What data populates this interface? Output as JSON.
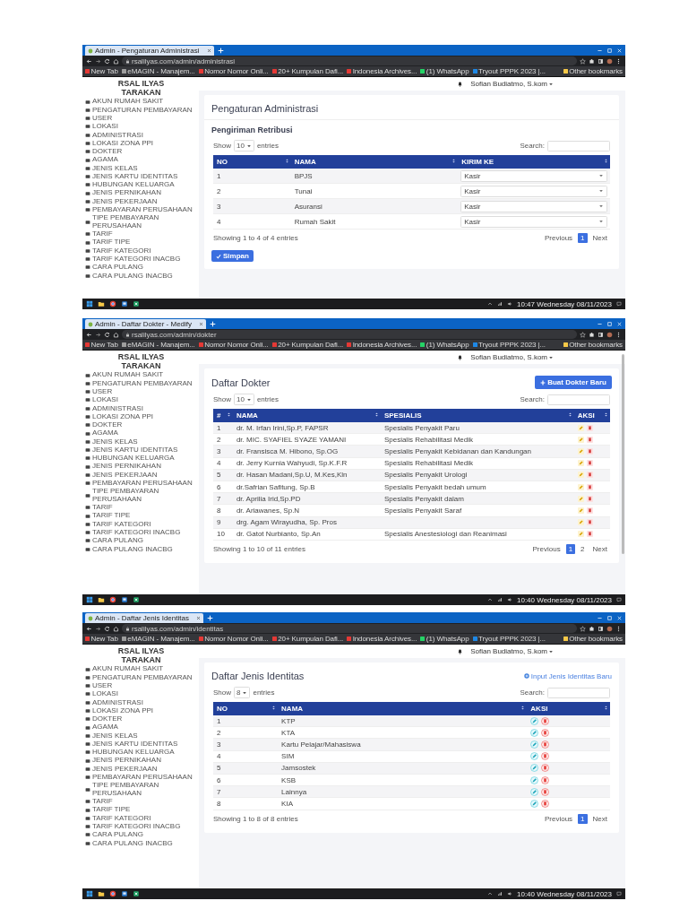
{
  "screens": [
    {
      "browser": {
        "tab_title": "Admin - Pengaturan Administrasi",
        "url": "rsalilyas.com/admin/administrasi",
        "bookmarks": [
          "New Tab",
          "eMAGIN - Manajem...",
          "Nomor Nomor Onli...",
          "20+ Kumpulan Dafi...",
          "Indonesia Archives...",
          "(1) WhatsApp",
          "Tryout PPPK 2023 |..."
        ],
        "other_bookmarks": "Other bookmarks"
      },
      "sidebar": {
        "brand": "RSAL ILYAS TARAKAN",
        "items": [
          "AKUN RUMAH SAKIT",
          "PENGATURAN PEMBAYARAN",
          "USER",
          "LOKASI",
          "ADMINISTRASI",
          "LOKASI ZONA PPI",
          "DOKTER",
          "AGAMA",
          "JENIS KELAS",
          "JENIS KARTU IDENTITAS",
          "HUBUNGAN KELUARGA",
          "JENIS PERNIKAHAN",
          "JENIS PEKERJAAN",
          "PEMBAYARAN PERUSAHAAN",
          "TIPE PEMBAYARAN PERUSAHAAN",
          "TARIF",
          "TARIF TIPE",
          "TARIF KATEGORI",
          "TARIF KATEGORI INACBG",
          "CARA PULANG",
          "CARA PULANG INACBG"
        ]
      },
      "navbar": {
        "user": "Sofian Budiatmo, S.kom"
      },
      "content": {
        "title": "Pengaturan Administrasi",
        "section_title": "Pengiriman Retribusi",
        "show_label": "Show",
        "length_value": "10",
        "entries_label": "entries",
        "search_label": "Search:",
        "columns": [
          {
            "label": "NO",
            "kind": "text"
          },
          {
            "label": "NAMA",
            "kind": "text"
          },
          {
            "label": "KIRIM KE",
            "kind": "select"
          }
        ],
        "rows": [
          [
            "1",
            "BPJS",
            "Kasir"
          ],
          [
            "2",
            "Tunai",
            "Kasir"
          ],
          [
            "3",
            "Asuransi",
            "Kasir"
          ],
          [
            "4",
            "Rumah Sakit",
            "Kasir"
          ]
        ],
        "info": "Showing 1 to 4 of 4 entries",
        "pages": [
          {
            "label": "Previous",
            "selected": false
          },
          {
            "label": "1",
            "selected": true
          },
          {
            "label": "Next",
            "selected": false
          }
        ],
        "submit": "Simpan"
      },
      "taskbar": {
        "time": "10:47",
        "day": "Wednesday",
        "date": "08/11/2023"
      }
    },
    {
      "browser": {
        "tab_title": "Admin - Daftar Dokter - Medify",
        "url": "rsalilyas.com/admin/dokter",
        "bookmarks": [
          "New Tab",
          "eMAGIN - Manajem...",
          "Nomor Nomor Onli...",
          "20+ Kumpulan Dafi...",
          "Indonesia Archives...",
          "(1) WhatsApp",
          "Tryout PPPK 2023 |..."
        ],
        "other_bookmarks": "Other bookmarks"
      },
      "sidebar": {
        "brand": "RSAL ILYAS TARAKAN",
        "items": [
          "AKUN RUMAH SAKIT",
          "PENGATURAN PEMBAYARAN",
          "USER",
          "LOKASI",
          "ADMINISTRASI",
          "LOKASI ZONA PPI",
          "DOKTER",
          "AGAMA",
          "JENIS KELAS",
          "JENIS KARTU IDENTITAS",
          "HUBUNGAN KELUARGA",
          "JENIS PERNIKAHAN",
          "JENIS PEKERJAAN",
          "PEMBAYARAN PERUSAHAAN",
          "TIPE PEMBAYARAN PERUSAHAAN",
          "TARIF",
          "TARIF TIPE",
          "TARIF KATEGORI",
          "TARIF KATEGORI INACBG",
          "CARA PULANG",
          "CARA PULANG INACBG"
        ]
      },
      "navbar": {
        "user": "Sofian Budiatmo, S.kom"
      },
      "content": {
        "title": "Daftar Dokter",
        "action": {
          "kind": "button",
          "label": "Buat Dokter Baru"
        },
        "show_label": "Show",
        "length_value": "10",
        "entries_label": "entries",
        "search_label": "Search:",
        "columns": [
          {
            "label": "#",
            "kind": "text"
          },
          {
            "label": "NAMA",
            "kind": "text"
          },
          {
            "label": "SPESIALIS",
            "kind": "text"
          },
          {
            "label": "AKSI",
            "kind": "actions"
          }
        ],
        "rows": [
          [
            "1",
            "dr. M. Irfan Irini,Sp.P, FAPSR",
            "Spesialis Penyakit Paru"
          ],
          [
            "2",
            "dr. MIC. SYAFIEL SYAZE YAMANI",
            "Spesialis Rehabilitasi Medik"
          ],
          [
            "3",
            "dr. Fransisca M. Hibono, Sp.OG",
            "Spesialis Penyakit Kebidanan dan Kandungan"
          ],
          [
            "4",
            "dr. Jerry Kurnia Wahyudi, Sp.K.F.R",
            "Spesialis Rehabilitasi Medik"
          ],
          [
            "5",
            "dr. Hasan Madani,Sp.U, M.Kes,Kln",
            "Spesialis Penyakit Urologi"
          ],
          [
            "6",
            "dr.Safrian Safitung, Sp.B",
            "Spesialis Penyakit bedah umum"
          ],
          [
            "7",
            "dr. Aprilia Irid,Sp.PD",
            "Spesialis Penyakit dalam"
          ],
          [
            "8",
            "dr. Ariawanes, Sp.N",
            "Spesialis Penyakit Saraf"
          ],
          [
            "9",
            "drg. Agam Wirayudha, Sp. Pros",
            null
          ],
          [
            "10",
            "dr. Gatot Nurbianto, Sp.An",
            "Spesialis Anestesiologi dan Reanimasi"
          ]
        ],
        "info": "Showing 1 to 10 of 11 entries",
        "pages": [
          {
            "label": "Previous",
            "selected": false
          },
          {
            "label": "1",
            "selected": true
          },
          {
            "label": "2",
            "selected": false
          },
          {
            "label": "Next",
            "selected": false
          }
        ]
      },
      "scrollbar": true,
      "taskbar": {
        "time": "10:40",
        "day": "Wednesday",
        "date": "08/11/2023"
      }
    },
    {
      "browser": {
        "tab_title": "Admin - Daftar Jenis Identitas",
        "url": "rsalilyas.com/admin/identitas",
        "bookmarks": [
          "New Tab",
          "eMAGIN - Manajem...",
          "Nomor Nomor Onli...",
          "20+ Kumpulan Dafi...",
          "Indonesia Archives...",
          "(1) WhatsApp",
          "Tryout PPPK 2023 |..."
        ],
        "other_bookmarks": "Other bookmarks"
      },
      "sidebar": {
        "brand": "RSAL ILYAS TARAKAN",
        "items": [
          "AKUN RUMAH SAKIT",
          "PENGATURAN PEMBAYARAN",
          "USER",
          "LOKASI",
          "ADMINISTRASI",
          "LOKASI ZONA PPI",
          "DOKTER",
          "AGAMA",
          "JENIS KELAS",
          "JENIS KARTU IDENTITAS",
          "HUBUNGAN KELUARGA",
          "JENIS PERNIKAHAN",
          "JENIS PEKERJAAN",
          "PEMBAYARAN PERUSAHAAN",
          "TIPE PEMBAYARAN PERUSAHAAN",
          "TARIF",
          "TARIF TIPE",
          "TARIF KATEGORI",
          "TARIF KATEGORI INACBG",
          "CARA PULANG",
          "CARA PULANG INACBG"
        ]
      },
      "navbar": {
        "user": "Sofian Budiatmo, S.kom"
      },
      "content": {
        "title": "Daftar Jenis Identitas",
        "action": {
          "kind": "link",
          "label": "Input Jenis Identitas Baru"
        },
        "show_label": "Show",
        "length_value": "8",
        "entries_label": "entries",
        "search_label": "Search:",
        "columns": [
          {
            "label": "NO",
            "kind": "text"
          },
          {
            "label": "NAMA",
            "kind": "text"
          },
          {
            "label": "AKSI",
            "kind": "roundactions"
          }
        ],
        "rows": [
          [
            "1",
            "KTP"
          ],
          [
            "2",
            "KTA"
          ],
          [
            "3",
            "Kartu Pelajar/Mahasiswa"
          ],
          [
            "4",
            "SIM"
          ],
          [
            "5",
            "Jamsostek"
          ],
          [
            "6",
            "KSB"
          ],
          [
            "7",
            "Lainnya"
          ],
          [
            "8",
            "KIA"
          ]
        ],
        "info": "Showing 1 to 8 of 8 entries",
        "pages": [
          {
            "label": "Previous",
            "selected": false
          },
          {
            "label": "1",
            "selected": true
          },
          {
            "label": "Next",
            "selected": false
          }
        ]
      },
      "taskbar": {
        "time": "10:40",
        "day": "Wednesday",
        "date": "08/11/2023"
      }
    }
  ]
}
